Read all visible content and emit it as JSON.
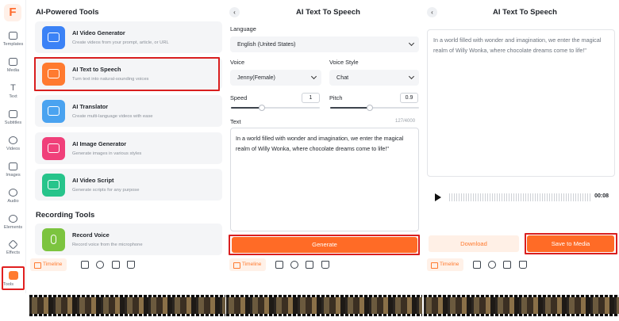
{
  "app": {
    "logo_letter": "F"
  },
  "sidebar": {
    "items": [
      {
        "label": "Templates",
        "icon": "templates-icon"
      },
      {
        "label": "Media",
        "icon": "media-icon"
      },
      {
        "label": "Text",
        "icon": "text-icon"
      },
      {
        "label": "Subtitles",
        "icon": "subtitles-icon"
      },
      {
        "label": "Videos",
        "icon": "videos-icon"
      },
      {
        "label": "Images",
        "icon": "images-icon"
      },
      {
        "label": "Audio",
        "icon": "audio-icon"
      },
      {
        "label": "Elements",
        "icon": "elements-icon"
      },
      {
        "label": "Effects",
        "icon": "effects-icon"
      },
      {
        "label": "Tools",
        "icon": "tools-icon",
        "active": true
      }
    ]
  },
  "tools_panel": {
    "ai_section_title": "AI-Powered Tools",
    "ai_tools": [
      {
        "name": "AI Video Generator",
        "desc": "Create videos from your prompt, article, or URL",
        "color": "#3b82f6",
        "icon": "ai-video-icon"
      },
      {
        "name": "AI Text to Speech",
        "desc": "Turn text into natural-sounding voices",
        "color": "#ff7a2f",
        "icon": "speech-bubble-icon"
      },
      {
        "name": "AI Translator",
        "desc": "Create multi-language videos with ease",
        "color": "#4aa3f0",
        "icon": "translate-icon"
      },
      {
        "name": "AI Image Generator",
        "desc": "Generate images in various styles",
        "color": "#f0407a",
        "icon": "ai-image-icon"
      },
      {
        "name": "AI Video Script",
        "desc": "Generate scripts for any purpose",
        "color": "#27c48b",
        "icon": "script-icon"
      }
    ],
    "recording_section_title": "Recording Tools",
    "recording_tools": [
      {
        "name": "Record Voice",
        "desc": "Record voice from the microphone",
        "color": "#7cc43f",
        "icon": "microphone-icon"
      }
    ]
  },
  "tts_panel": {
    "back_glyph": "‹",
    "title": "AI Text To Speech",
    "language_label": "Language",
    "language_value": "English (United States)",
    "voice_label": "Voice",
    "voice_value": "Jenny(Female)",
    "voice_style_label": "Voice Style",
    "voice_style_value": "Chat",
    "speed_label": "Speed",
    "speed_value": "1",
    "speed_level": 0.35,
    "pitch_label": "Pitch",
    "pitch_value": "0.9",
    "pitch_level": 0.45,
    "text_label": "Text",
    "text_counter": "127/4000",
    "text_value": "In a world filled with wonder and imagination, we enter the magical realm of Willy Wonka, where chocolate dreams come to life!\"",
    "generate_label": "Generate"
  },
  "result_panel": {
    "back_glyph": "‹",
    "title": "AI Text To Speech",
    "text_value": "In a world filled with wonder and imagination, we enter the magical realm of Willy Wonka, where chocolate dreams come to life!\"",
    "duration": "00:08",
    "download_label": "Download",
    "save_label": "Save to Media"
  },
  "bottom_bar": {
    "timeline_label": "Timeline"
  },
  "colors": {
    "accent": "#ff6b26",
    "highlight_box": "#d91f1f"
  }
}
